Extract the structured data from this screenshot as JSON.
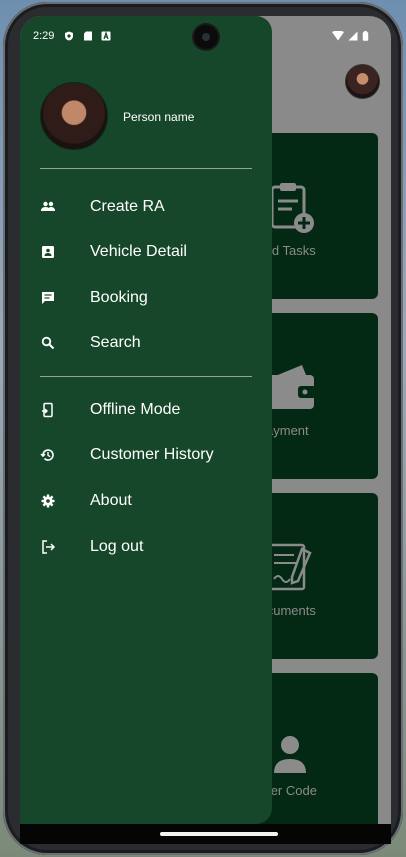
{
  "status_bar": {
    "time": "2:29"
  },
  "drawer": {
    "profile": {
      "name": "Person name"
    },
    "menu": [
      {
        "label": "Create RA",
        "icon": "people-icon"
      },
      {
        "label": "Vehicle Detail",
        "icon": "id-card-icon"
      },
      {
        "label": "Booking",
        "icon": "chat-icon"
      },
      {
        "label": "Search",
        "icon": "search-icon"
      },
      {
        "label": "Offline Mode",
        "icon": "phone-offline-icon"
      },
      {
        "label": "Customer History",
        "icon": "history-icon"
      },
      {
        "label": "About",
        "icon": "gear-icon"
      },
      {
        "label": "Log out",
        "icon": "logout-icon"
      }
    ]
  },
  "background_tiles": [
    {
      "label": "gned Tasks",
      "icon": "clipboard-add-icon"
    },
    {
      "label": "Payment",
      "icon": "wallet-icon"
    },
    {
      "label": "Documents",
      "icon": "document-pen-icon"
    },
    {
      "label": "tomer Code",
      "icon": "person-icon"
    }
  ]
}
